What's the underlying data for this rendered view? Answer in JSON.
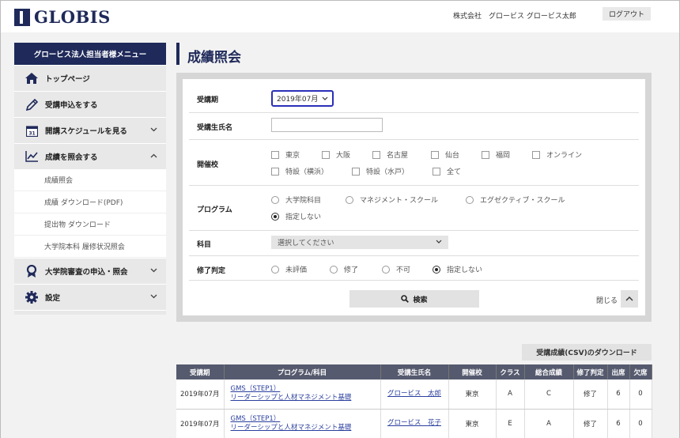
{
  "header": {
    "logo_text": "GLOBIS",
    "company_user": "株式会社　グロービス グロービス太郎",
    "logout_label": "ログアウト"
  },
  "sidebar": {
    "title": "グロービス法人担当者様メニュー",
    "items": [
      {
        "label": "トップページ",
        "icon": "home-icon"
      },
      {
        "label": "受講申込をする",
        "icon": "pencil-icon"
      },
      {
        "label": "開講スケジュールを見る",
        "icon": "calendar-icon",
        "calendar_day": "31"
      },
      {
        "label": "成績を照会する",
        "icon": "chart-icon"
      },
      {
        "label": "大学院審査の申込・照会",
        "icon": "award-icon"
      },
      {
        "label": "設定",
        "icon": "gear-icon"
      }
    ],
    "subitems": [
      "成績照会",
      "成績 ダウンロード(PDF)",
      "提出物 ダウンロード",
      "大学院本科 履修状況照会"
    ]
  },
  "page": {
    "title": "成績照会"
  },
  "form": {
    "period": {
      "label": "受講期",
      "value": "2019年07月"
    },
    "student_name": {
      "label": "受講生氏名",
      "value": ""
    },
    "campus": {
      "label": "開催校",
      "options": [
        "東京",
        "大阪",
        "名古屋",
        "仙台",
        "福岡",
        "オンライン",
        "特設（横浜）",
        "特設（水戸）",
        "全て"
      ]
    },
    "program": {
      "label": "プログラム",
      "options": [
        "大学院科目",
        "マネジメント・スクール",
        "エグゼクティブ・スクール",
        "指定しない"
      ],
      "selected": "指定しない"
    },
    "subject": {
      "label": "科目",
      "placeholder": "選択してください"
    },
    "completion": {
      "label": "修了判定",
      "options": [
        "未評価",
        "修了",
        "不可",
        "指定しない"
      ],
      "selected": "指定しない"
    },
    "search_label": "検索",
    "close_label": "閉じる"
  },
  "csv_button_label": "受講成績(CSV)のダウンロード",
  "table": {
    "headers": [
      "受講期",
      "プログラム/科目",
      "受講生氏名",
      "開催校",
      "クラス",
      "総合成績",
      "修了判定",
      "出席",
      "欠席"
    ],
    "rows": [
      {
        "period": "2019年07月",
        "program": "GMS（STEP1）",
        "subject": "リーダーシップと人材マネジメント基礎",
        "name": "グロービス　太郎",
        "campus": "東京",
        "class": "A",
        "grade": "C",
        "completion": "修了",
        "attend": "6",
        "absent": "0"
      },
      {
        "period": "2019年07月",
        "program": "GMS（STEP1）",
        "subject": "リーダーシップと人材マネジメント基礎",
        "name": "グロービス　花子",
        "campus": "東京",
        "class": "E",
        "grade": "A",
        "completion": "修了",
        "attend": "6",
        "absent": "0"
      }
    ]
  },
  "colors": {
    "navy": "#1f2a5a",
    "focus_border": "#2b2fb8",
    "table_header": "#555a6e",
    "link": "#2a3f9e"
  }
}
